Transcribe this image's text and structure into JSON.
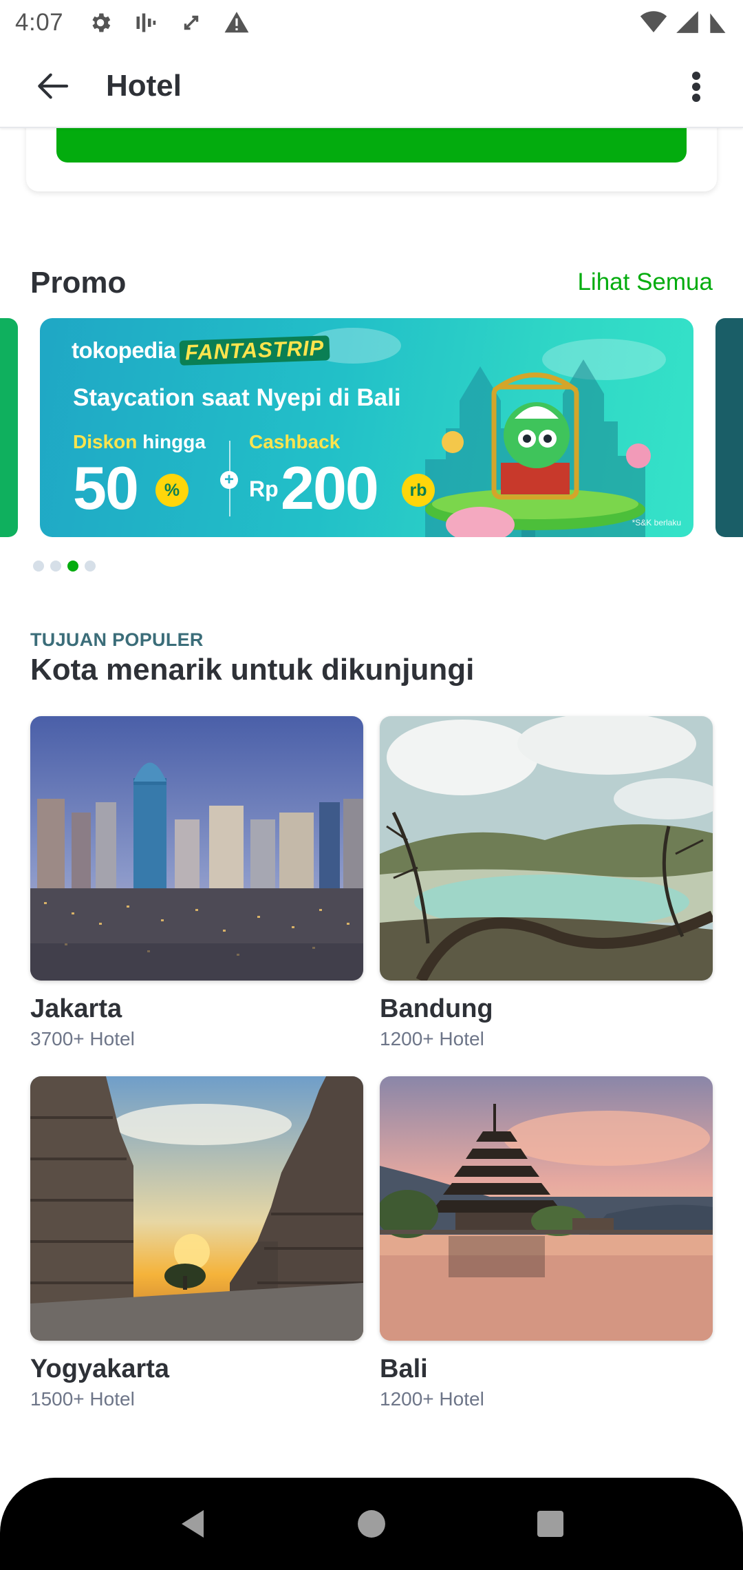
{
  "status_bar": {
    "time": "4:07",
    "icons_left": [
      "gear-icon",
      "signal-bars-icon",
      "sync-icon",
      "warning-icon"
    ],
    "icons_right": [
      "wifi-icon",
      "cell-signal-icon",
      "battery-icon"
    ]
  },
  "app_bar": {
    "title": "Hotel",
    "back_icon": "arrow-left-icon",
    "more_icon": "more-vertical-icon"
  },
  "promo": {
    "title": "Promo",
    "see_all": "Lihat Semua",
    "banner": {
      "brand": "tokopedia",
      "campaign": "FANTASTRIP",
      "headline": "Staycation saat Nyepi di Bali",
      "discount_label": "Diskon",
      "discount_label_2": "hingga",
      "discount_value": "50",
      "discount_unit": "%",
      "cashback_label": "Cashback",
      "currency": "Rp",
      "cashback_value": "200",
      "cashback_unit": "rb",
      "terms": "*S&K berlaku"
    },
    "carousel_pages": 4,
    "active_page": 3
  },
  "popular": {
    "eyebrow": "TUJUAN POPULER",
    "title": "Kota menarik untuk dikunjungi",
    "cities": [
      {
        "name": "Jakarta",
        "count": "3700+ Hotel"
      },
      {
        "name": "Bandung",
        "count": "1200+ Hotel"
      },
      {
        "name": "Yogyakarta",
        "count": "1500+ Hotel"
      },
      {
        "name": "Bali",
        "count": "1200+ Hotel"
      }
    ]
  },
  "colors": {
    "accent": "#03ac0e",
    "eyebrow": "#3b6d79",
    "text": "#2e3137",
    "muted": "#6d7588"
  },
  "nav": {
    "icons": [
      "back-triangle-icon",
      "home-circle-icon",
      "recents-square-icon"
    ]
  }
}
